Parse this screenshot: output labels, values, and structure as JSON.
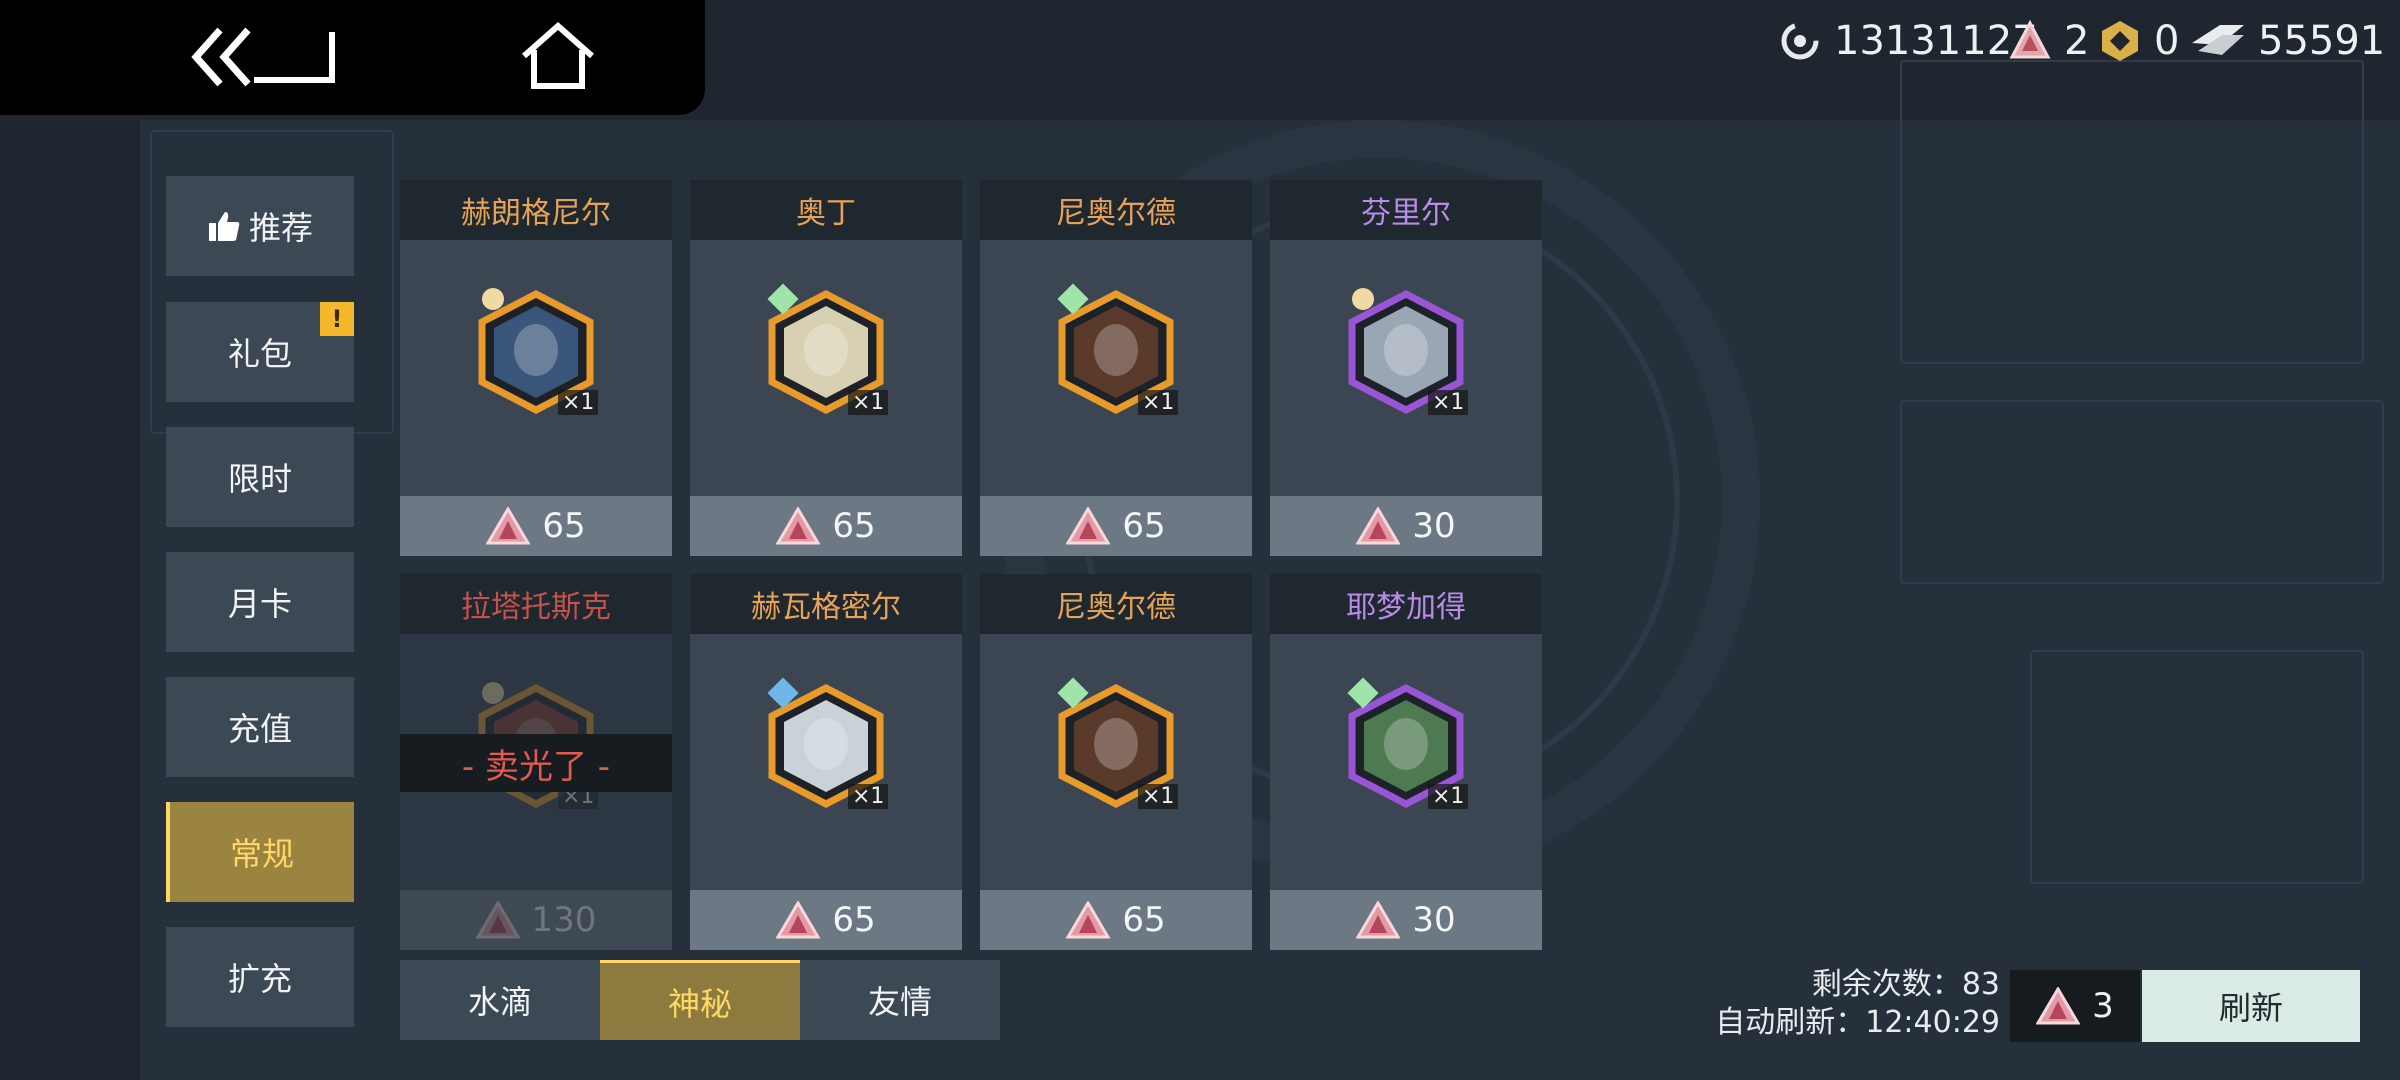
{
  "header": {
    "back_icon": "double-chevron-left-icon",
    "home_icon": "home-icon"
  },
  "currencies": [
    {
      "icon": "energy-core-icon",
      "value": "13131127"
    },
    {
      "icon": "red-gem-icon",
      "value": "2"
    },
    {
      "icon": "gold-badge-icon",
      "value": "0"
    },
    {
      "icon": "wing-icon",
      "value": "55591"
    }
  ],
  "sidebar": {
    "items": [
      {
        "label": "推荐",
        "icon": "thumbs-up-icon"
      },
      {
        "label": "礼包",
        "badge": "!"
      },
      {
        "label": "限时"
      },
      {
        "label": "月卡"
      },
      {
        "label": "充值"
      },
      {
        "label": "常规",
        "active": true
      },
      {
        "label": "扩充"
      }
    ]
  },
  "shop": {
    "items": [
      {
        "name": "赫朗格尼尔",
        "qty": "×1",
        "price": "65",
        "name_color": "#e6a257",
        "frame": "#e89a2a",
        "portrait": "#3a567a",
        "rarity": "#f1d9a3",
        "soldout": false
      },
      {
        "name": "奥丁",
        "qty": "×1",
        "price": "65",
        "name_color": "#e6a257",
        "frame": "#e89a2a",
        "portrait": "#d8d0b2",
        "rarity": "#9fe4a8",
        "soldout": false
      },
      {
        "name": "尼奥尔德",
        "qty": "×1",
        "price": "65",
        "name_color": "#e6a257",
        "frame": "#e89a2a",
        "portrait": "#5a3a2a",
        "rarity": "#9fe4a8",
        "soldout": false
      },
      {
        "name": "芬里尔",
        "qty": "×1",
        "price": "30",
        "name_color": "#b88ce8",
        "frame": "#9a55d6",
        "portrait": "#9aa6b4",
        "rarity": "#f1d9a3",
        "soldout": false
      },
      {
        "name": "拉塔托斯克",
        "qty": "×1",
        "price": "130",
        "name_color": "#c4534b",
        "frame": "#e89a2a",
        "portrait": "#8a3a2a",
        "rarity": "#f1d9a3",
        "soldout": true,
        "sold_label": "- 卖光了 -"
      },
      {
        "name": "赫瓦格密尔",
        "qty": "×1",
        "price": "65",
        "name_color": "#e6a257",
        "frame": "#e89a2a",
        "portrait": "#c9d2d8",
        "rarity": "#6fb7e8",
        "soldout": false
      },
      {
        "name": "尼奥尔德",
        "qty": "×1",
        "price": "65",
        "name_color": "#e6a257",
        "frame": "#e89a2a",
        "portrait": "#5a3a2a",
        "rarity": "#9fe4a8",
        "soldout": false
      },
      {
        "name": "耶梦加得",
        "qty": "×1",
        "price": "30",
        "name_color": "#b88ce8",
        "frame": "#9a55d6",
        "portrait": "#4d7a50",
        "rarity": "#9fe4a8",
        "soldout": false
      }
    ]
  },
  "tabs": [
    {
      "label": "水滴"
    },
    {
      "label": "神秘",
      "active": true
    },
    {
      "label": "友情"
    }
  ],
  "refresh": {
    "remaining_label": "剩余次数：",
    "remaining_value": "83",
    "auto_label": "自动刷新：",
    "auto_time": "12:40:29",
    "cost": "3",
    "button_label": "刷新"
  }
}
